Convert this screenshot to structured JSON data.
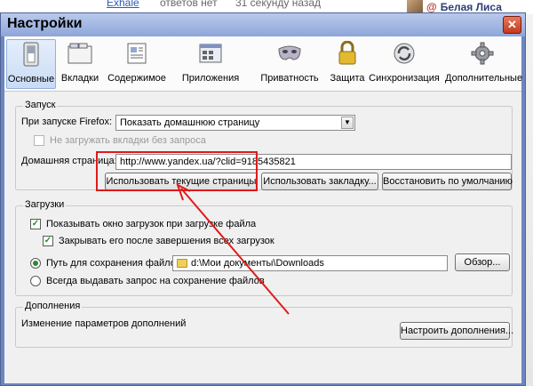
{
  "background": {
    "link": "Exhale",
    "answers": "ответов нет",
    "time": "31 секунду назад",
    "user_at": "@",
    "user_name": "Белая Лиса"
  },
  "window": {
    "title": "Настройки",
    "close": "✕"
  },
  "toolbar": [
    {
      "label": "Основные",
      "icon": "general-switch-icon",
      "active": true
    },
    {
      "label": "Вкладки",
      "icon": "tabs-window-icon"
    },
    {
      "label": "Содержимое",
      "icon": "content-document-icon"
    },
    {
      "label": "Приложения",
      "icon": "applications-icon"
    },
    {
      "label": "Приватность",
      "icon": "privacy-mask-icon"
    },
    {
      "label": "Защита",
      "icon": "security-lock-icon"
    },
    {
      "label": "Синхронизация",
      "icon": "sync-icon"
    },
    {
      "label": "Дополнительные",
      "icon": "advanced-gear-icon"
    }
  ],
  "startup": {
    "group_label": "Запуск",
    "when_label": "При запуске Firefox:",
    "when_value": "Показать домашнюю страницу",
    "dont_load_tabs": "Не загружать вкладки без запроса",
    "home_label": "Домашняя страница:",
    "home_value": "http://www.yandex.ua/?clid=9185435821",
    "use_current": "Использовать текущие страницы",
    "use_bookmark": "Использовать закладку...",
    "restore_default": "Восстановить по умолчанию"
  },
  "downloads": {
    "group_label": "Загрузки",
    "show_window": "Показывать окно загрузок при загрузке файла",
    "close_when_done": "Закрывать его после завершения всех загрузок",
    "save_path_label": "Путь для сохранения файлов",
    "save_path_value": "d:\\Мои документы\\Downloads",
    "browse": "Обзор...",
    "always_ask": "Всегда выдавать запрос на сохранение файлов"
  },
  "addons": {
    "group_label": "Дополнения",
    "description": "Изменение параметров дополнений",
    "configure": "Настроить дополнения..."
  },
  "colors": {
    "window_frame": "#6e86c0",
    "annotation": "#e01a1a",
    "check": "#2a8a2a"
  }
}
